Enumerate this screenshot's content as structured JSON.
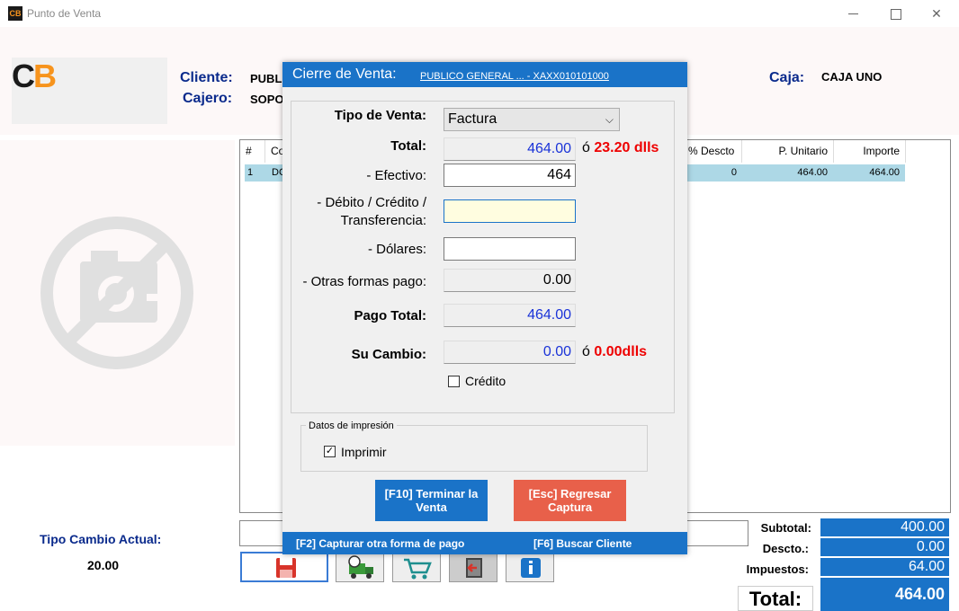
{
  "window": {
    "app_icon": "CB",
    "title": "Punto de Venta",
    "minimize": "",
    "maximize": "",
    "close": "✕"
  },
  "header": {
    "logo_c": "C",
    "logo_b": "B",
    "cliente_label": "Cliente:",
    "cliente_value": "PUBL",
    "cajero_label": "Cajero:",
    "cajero_value": "SOPO",
    "caja_label": "Caja:",
    "caja_value": "CAJA UNO"
  },
  "grid": {
    "headers": [
      "#",
      "Co",
      "% Descto",
      "P. Unitario",
      "Importe"
    ],
    "rows": [
      {
        "num": "1",
        "code": "DC",
        "descto": "0",
        "p_unitario": "464.00",
        "importe": "464.00"
      }
    ]
  },
  "tipo_cambio": {
    "label": "Tipo Cambio Actual:",
    "value": "20.00"
  },
  "totals": {
    "subtotal_label": "Subtotal:",
    "subtotal_value": "400.00",
    "descto_label": "Descto.:",
    "descto_value": "0.00",
    "impuestos_label": "Impuestos:",
    "impuestos_value": "64.00",
    "total_label": "Total:",
    "total_value": "464.00"
  },
  "modal": {
    "title": "Cierre de Venta:",
    "client": "PUBLICO GENERAL ... - XAXX010101000",
    "tipo_venta_label": "Tipo de Venta:",
    "tipo_venta_value": "Factura",
    "total_label": "Total:",
    "total_value": "464.00",
    "total_dlls_prefix": "ó",
    "total_dlls": "23.20 dlls",
    "efectivo_label": "- Efectivo:",
    "efectivo_value": "464",
    "debito_label_1": "- Débito / Crédito /",
    "debito_label_2": "Transferencia:",
    "debito_value": "",
    "dolares_label": "- Dólares:",
    "dolares_value": "",
    "otras_label": "- Otras formas pago:",
    "otras_value": "0.00",
    "pago_total_label": "Pago Total:",
    "pago_total_value": "464.00",
    "cambio_label": "Su Cambio:",
    "cambio_value": "0.00",
    "cambio_dlls_prefix": "ó",
    "cambio_dlls": "0.00dlls",
    "credito_label": "Crédito",
    "credito_checked": false,
    "print_group_label": "Datos de impresión",
    "imprimir_label": "Imprimir",
    "imprimir_mark": "✓",
    "btn_terminar": "[F10] Terminar la Venta",
    "btn_regresar": "[Esc] Regresar Captura",
    "footer_otra_forma": "[F2] Capturar otra forma de pago",
    "footer_buscar": "[F6] Buscar Cliente"
  },
  "colors": {
    "accent_blue": "#1a73c8",
    "danger": "#e8604a",
    "label_blue": "#0a2a8c"
  }
}
